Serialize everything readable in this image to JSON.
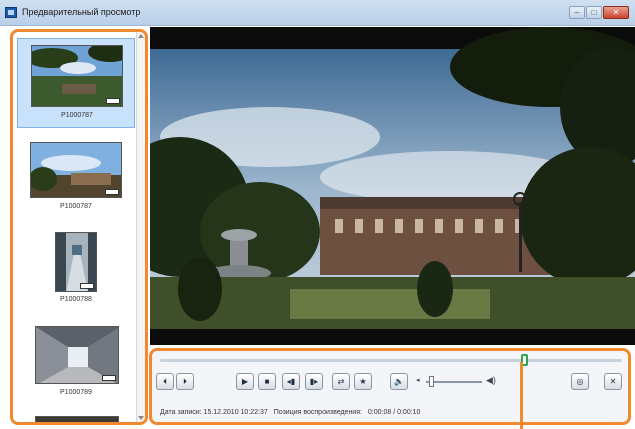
{
  "window": {
    "title": "Предварительный просмотр"
  },
  "title_buttons": {
    "minimize": "–",
    "maximize": "□",
    "close": "✕"
  },
  "sidebar": {
    "items": [
      {
        "label": "P1000787",
        "selected": true,
        "scene": "park-sky"
      },
      {
        "label": "P1000787",
        "selected": false,
        "scene": "town-sky"
      },
      {
        "label": "P1000788",
        "selected": false,
        "scene": "street-portrait"
      },
      {
        "label": "P1000789",
        "selected": false,
        "scene": "arcade"
      }
    ]
  },
  "playback": {
    "seek_position": 0.79,
    "volume_level": 0.05,
    "buttons": {
      "prev": "⏴",
      "next": "⏵",
      "play": "▶",
      "stop": "■",
      "step_back": "◂▮",
      "step_fwd": "▮▸",
      "repeat": "⇄",
      "favorite": "★",
      "mute": "🔈",
      "snapshot": "◎",
      "close": "✕"
    },
    "vol_min_icon": "◂",
    "vol_max_icon": "◀)",
    "info": {
      "date_label": "Дата записи: 15.12.2010 10:22:37",
      "position_label": "Позиция воспроизведения:",
      "position_value": "0:00:08 / 0:00:10"
    }
  },
  "colors": {
    "highlight": "#f0892f",
    "seek_thumb": "#2ca24e",
    "selection": "#c7e2fa"
  }
}
